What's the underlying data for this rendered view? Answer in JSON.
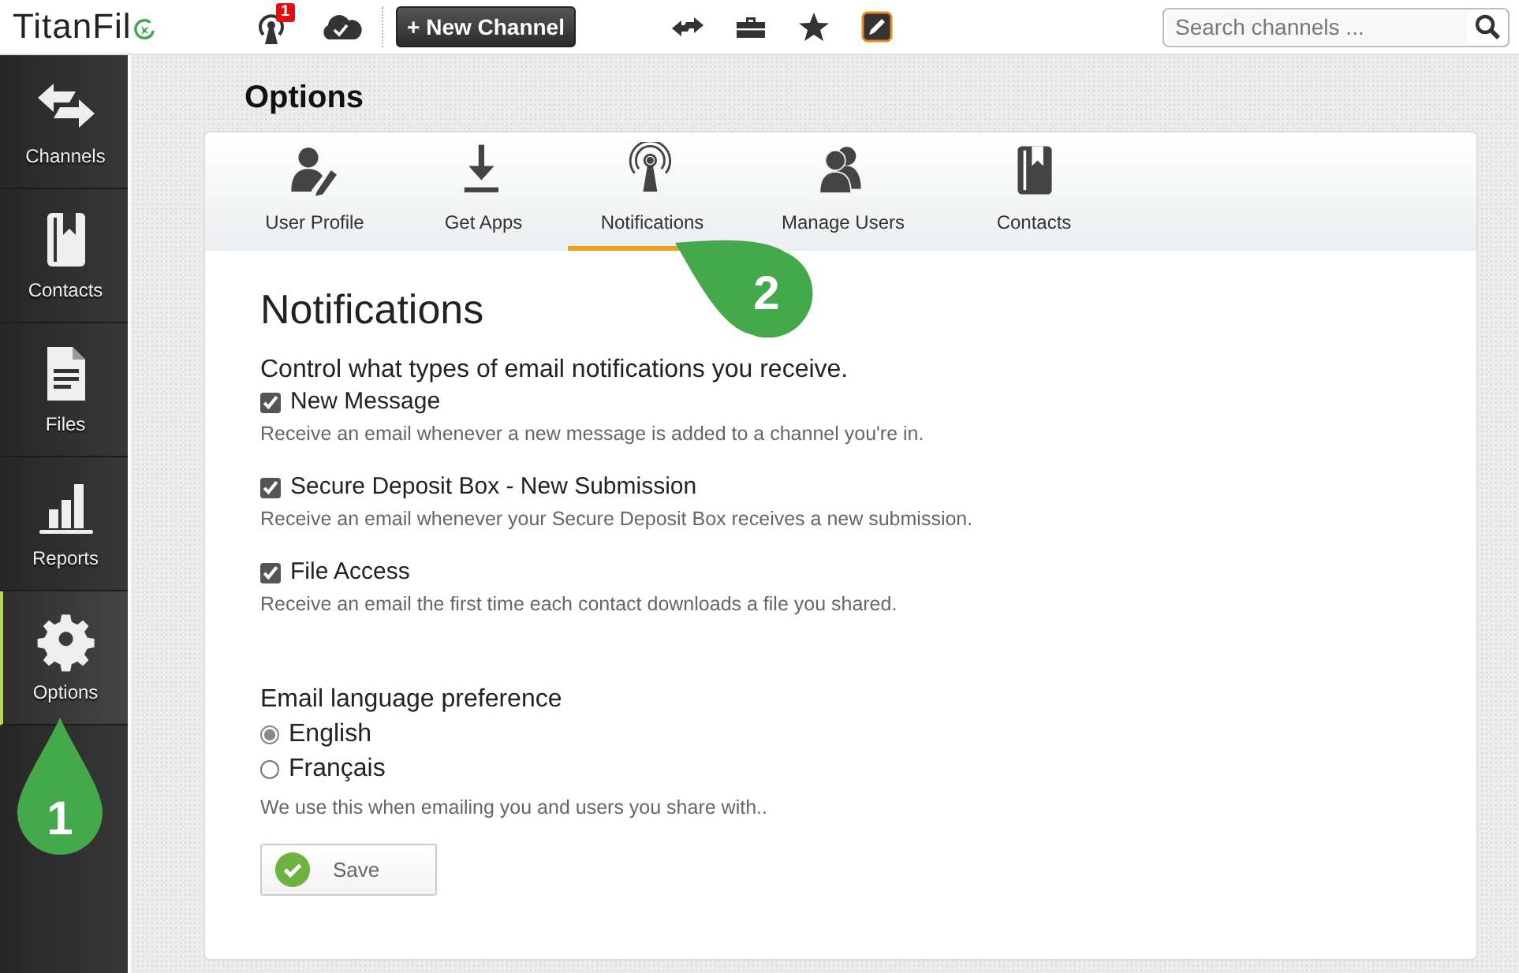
{
  "header": {
    "logo_text": "TitanFil",
    "notification_badge": "1",
    "new_channel_button": "+ New Channel",
    "search": {
      "placeholder": "Search channels ..."
    }
  },
  "sidebar": {
    "items": [
      {
        "label": "Channels",
        "kind": "arrows",
        "selected": false
      },
      {
        "label": "Contacts",
        "kind": "book",
        "selected": false
      },
      {
        "label": "Files",
        "kind": "file",
        "selected": false
      },
      {
        "label": "Reports",
        "kind": "chart",
        "selected": false
      },
      {
        "label": "Options",
        "kind": "gear",
        "selected": true
      }
    ]
  },
  "page_title": "Options",
  "tabs": [
    {
      "label": "User Profile",
      "kind": "user-edit",
      "selected": false
    },
    {
      "label": "Get Apps",
      "kind": "download",
      "selected": false
    },
    {
      "label": "Notifications",
      "kind": "antenna",
      "selected": true
    },
    {
      "label": "Manage Users",
      "kind": "users",
      "selected": false
    },
    {
      "label": "Contacts",
      "kind": "book",
      "selected": false
    }
  ],
  "section": {
    "title": "Notifications",
    "intro": "Control what types of email notifications you receive.",
    "options": [
      {
        "label": "New Message",
        "description": "Receive an email whenever a new message is added to a channel you're in.",
        "checked": true
      },
      {
        "label": "Secure Deposit Box - New Submission",
        "description": "Receive an email whenever your Secure Deposit Box receives a new submission.",
        "checked": true
      },
      {
        "label": "File Access",
        "description": "Receive an email the first time each contact downloads a file you shared.",
        "checked": true
      }
    ],
    "language": {
      "label": "Email language preference",
      "choices": [
        {
          "label": "English",
          "selected": true
        },
        {
          "label": "Français",
          "selected": false
        }
      ],
      "note": "We use this when emailing you and users you share with.."
    },
    "save_button": "Save"
  },
  "callouts": [
    {
      "number": "1",
      "kind": "up"
    },
    {
      "number": "2",
      "kind": "up-left"
    }
  ]
}
